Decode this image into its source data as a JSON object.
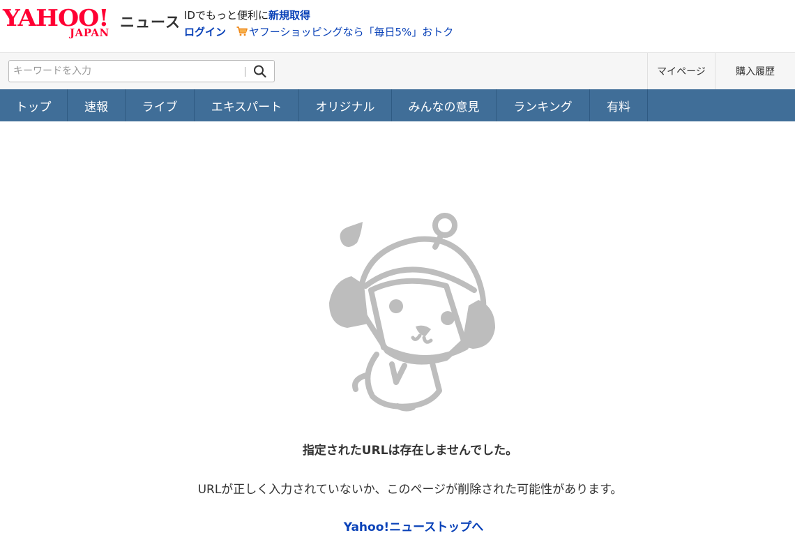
{
  "header": {
    "logo_text": "YAHOO!",
    "logo_sub": "JAPAN",
    "service_name": "ニュース",
    "promo_text": "IDでもっと便利に",
    "promo_link": "新規取得",
    "login_label": "ログイン",
    "shopping_text": "ヤフーショッピングなら「毎日5%」おトク"
  },
  "search": {
    "placeholder": "キーワードを入力",
    "value": ""
  },
  "utility": {
    "mypage_label": "マイページ",
    "history_label": "購入履歴"
  },
  "nav": {
    "items": [
      "トップ",
      "速報",
      "ライブ",
      "エキスパート",
      "オリジナル",
      "みんなの意見",
      "ランキング",
      "有料"
    ]
  },
  "main": {
    "error_title": "指定されたURLは存在しませんでした。",
    "error_message": "URLが正しく入力されていないか、このページが削除された可能性があります。",
    "top_link_label": "Yahoo!ニューストップへ"
  },
  "colors": {
    "brand_red": "#ff0033",
    "nav_blue": "#406e98",
    "link_blue": "#0a42b8",
    "illustration_gray": "#bdbdbd"
  },
  "icons": {
    "search": "search-icon",
    "cart": "cart-icon",
    "mascot": "mascot-illustration"
  }
}
